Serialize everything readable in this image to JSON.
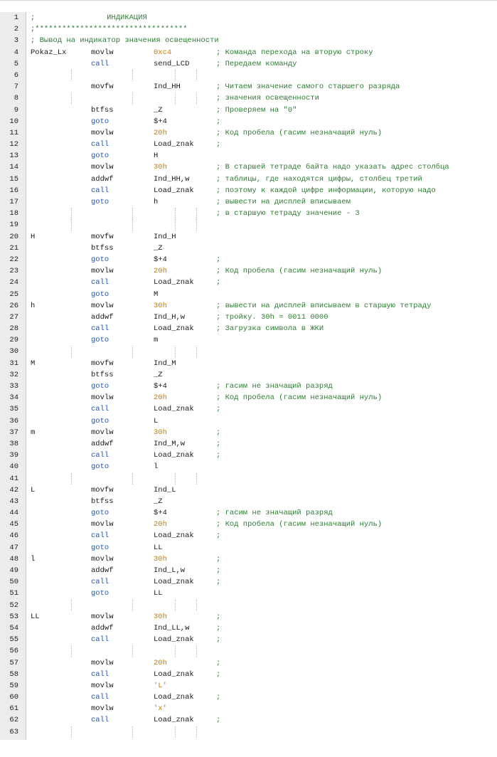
{
  "editor": {
    "lines": [
      {
        "n": "1",
        "full": ";                ИНДИКАЦИЯ"
      },
      {
        "n": "2",
        "full": ";**********************************"
      },
      {
        "n": "3",
        "full": "; Вывод на индикатор значения освещенности"
      },
      {
        "n": "4",
        "label": "Pokaz_Lx",
        "op": "movlw",
        "arg": "0xc4",
        "cmt": "; Команда перехода на вторую строку",
        "num": true
      },
      {
        "n": "5",
        "op": "call",
        "arg": "send_LCD",
        "cmt": "; Передаем команду",
        "blue": true
      },
      {
        "n": "6"
      },
      {
        "n": "7",
        "op": "movfw",
        "arg": "Ind_HH",
        "cmt": "; Читаем значение самого старшего разряда"
      },
      {
        "n": "8",
        "cmt": "; значения освещенности"
      },
      {
        "n": "9",
        "op": "btfss",
        "arg": "_Z",
        "cmt": "; Проверяем на \"0\""
      },
      {
        "n": "10",
        "op": "goto",
        "arg": "$+4",
        "cmt": ";",
        "blue": true
      },
      {
        "n": "11",
        "op": "movlw",
        "arg": "20h",
        "cmt": "; Код пробела (гасим незначащий нуль)",
        "num": true
      },
      {
        "n": "12",
        "op": "call",
        "arg": "Load_znak",
        "cmt": ";",
        "blue": true
      },
      {
        "n": "13",
        "op": "goto",
        "arg": "H",
        "blue": true
      },
      {
        "n": "14",
        "op": "movlw",
        "arg": "30h",
        "cmt": "; В старшей тетраде байта надо указать адрес столбца",
        "num": true
      },
      {
        "n": "15",
        "op": "addwf",
        "arg": "Ind_HH,w",
        "cmt": "; таблицы, где находятся цифры, столбец третий"
      },
      {
        "n": "16",
        "op": "call",
        "arg": "Load_znak",
        "cmt": "; поэтому к каждой цифре информации, которую надо",
        "blue": true
      },
      {
        "n": "17",
        "op": "goto",
        "arg": "h",
        "cmt": "; вывести на дисплей вписываем",
        "blue": true
      },
      {
        "n": "18",
        "cmt": "; в старшую тетраду значение - 3"
      },
      {
        "n": "19"
      },
      {
        "n": "20",
        "label": "H",
        "op": "movfw",
        "arg": "Ind_H"
      },
      {
        "n": "21",
        "op": "btfss",
        "arg": "_Z"
      },
      {
        "n": "22",
        "op": "goto",
        "arg": "$+4",
        "cmt": ";",
        "blue": true
      },
      {
        "n": "23",
        "op": "movlw",
        "arg": "20h",
        "cmt": "; Код пробела (гасим незначащий нуль)",
        "num": true
      },
      {
        "n": "24",
        "op": "call",
        "arg": "Load_znak",
        "cmt": ";",
        "blue": true
      },
      {
        "n": "25",
        "op": "goto",
        "arg": "M",
        "blue": true
      },
      {
        "n": "26",
        "label": "h",
        "op": "movlw",
        "arg": "30h",
        "cmt": "; вывести на дисплей вписываем в старшую тетраду",
        "num": true
      },
      {
        "n": "27",
        "op": "addwf",
        "arg": "Ind_H,w",
        "cmt": "; тройку. 30h = 0011 0000"
      },
      {
        "n": "28",
        "op": "call",
        "arg": "Load_znak",
        "cmt": "; Загрузка символа в ЖКИ",
        "blue": true
      },
      {
        "n": "29",
        "op": "goto",
        "arg": "m",
        "blue": true
      },
      {
        "n": "30"
      },
      {
        "n": "31",
        "label": "M",
        "op": "movfw",
        "arg": "Ind_M"
      },
      {
        "n": "32",
        "op": "btfss",
        "arg": "_Z"
      },
      {
        "n": "33",
        "op": "goto",
        "arg": "$+4",
        "cmt": "; гасим не значащий разряд",
        "blue": true
      },
      {
        "n": "34",
        "op": "movlw",
        "arg": "20h",
        "cmt": "; Код пробела (гасим незначащий нуль)",
        "num": true
      },
      {
        "n": "35",
        "op": "call",
        "arg": "Load_znak",
        "cmt": ";",
        "blue": true
      },
      {
        "n": "36",
        "op": "goto",
        "arg": "L",
        "blue": true
      },
      {
        "n": "37",
        "label": "m",
        "op": "movlw",
        "arg": "30h",
        "cmt": ";",
        "num": true
      },
      {
        "n": "38",
        "op": "addwf",
        "arg": "Ind_M,w",
        "cmt": ";"
      },
      {
        "n": "39",
        "op": "call",
        "arg": "Load_znak",
        "cmt": ";",
        "blue": true
      },
      {
        "n": "40",
        "op": "goto",
        "arg": "l",
        "blue": true
      },
      {
        "n": "41"
      },
      {
        "n": "42",
        "label": "L",
        "op": "movfw",
        "arg": "Ind_L"
      },
      {
        "n": "43",
        "op": "btfss",
        "arg": "_Z"
      },
      {
        "n": "44",
        "op": "goto",
        "arg": "$+4",
        "cmt": "; гасим не значащий разряд",
        "blue": true
      },
      {
        "n": "45",
        "op": "movlw",
        "arg": "20h",
        "cmt": "; Код пробела (гасим незначащий нуль)",
        "num": true
      },
      {
        "n": "46",
        "op": "call",
        "arg": "Load_znak",
        "cmt": ";",
        "blue": true
      },
      {
        "n": "47",
        "op": "goto",
        "arg": "LL",
        "blue": true
      },
      {
        "n": "48",
        "label": "l",
        "op": "movlw",
        "arg": "30h",
        "cmt": ";",
        "num": true
      },
      {
        "n": "49",
        "op": "addwf",
        "arg": "Ind_L,w",
        "cmt": ";"
      },
      {
        "n": "50",
        "op": "call",
        "arg": "Load_znak",
        "cmt": ";",
        "blue": true
      },
      {
        "n": "51",
        "op": "goto",
        "arg": "LL",
        "blue": true
      },
      {
        "n": "52"
      },
      {
        "n": "53",
        "label": "LL",
        "op": "movlw",
        "arg": "30h",
        "cmt": ";",
        "num": true
      },
      {
        "n": "54",
        "op": "addwf",
        "arg": "Ind_LL,w",
        "cmt": ";"
      },
      {
        "n": "55",
        "op": "call",
        "arg": "Load_znak",
        "cmt": ";",
        "blue": true
      },
      {
        "n": "56"
      },
      {
        "n": "57",
        "op": "movlw",
        "arg": "20h",
        "cmt": ";",
        "num": true
      },
      {
        "n": "58",
        "op": "call",
        "arg": "Load_znak",
        "cmt": ";",
        "blue": true
      },
      {
        "n": "59",
        "op": "movlw",
        "arg": "'L'",
        "num": true
      },
      {
        "n": "60",
        "op": "call",
        "arg": "Load_znak",
        "cmt": ";",
        "blue": true
      },
      {
        "n": "61",
        "op": "movlw",
        "arg": "'x'",
        "num": true
      },
      {
        "n": "62",
        "op": "call",
        "arg": "Load_znak",
        "cmt": ";",
        "blue": true
      },
      {
        "n": "63"
      }
    ]
  },
  "colors": {
    "comment": "#2e7d32",
    "keyword_blue": "#1a55b8",
    "number": "#c87b00",
    "gutter_bg": "#ececec"
  }
}
